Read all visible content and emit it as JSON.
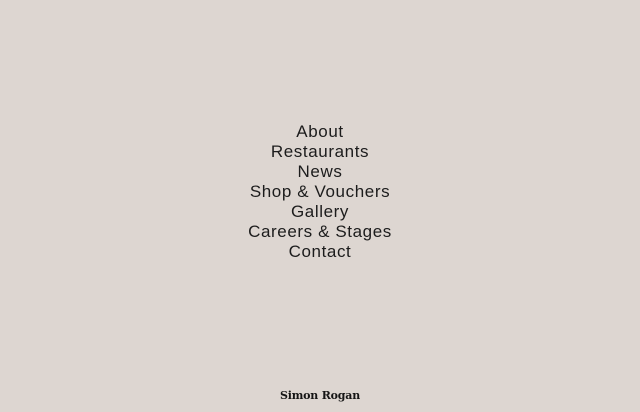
{
  "menu": {
    "items": [
      {
        "label": "About"
      },
      {
        "label": "Restaurants"
      },
      {
        "label": "News"
      },
      {
        "label": "Shop & Vouchers"
      },
      {
        "label": "Gallery"
      },
      {
        "label": "Careers & Stages"
      },
      {
        "label": "Contact"
      }
    ]
  },
  "footer": {
    "logo_text": "Simon Rogan"
  },
  "colors": {
    "background": "#ddd6d1",
    "text": "#1c1c1c"
  }
}
